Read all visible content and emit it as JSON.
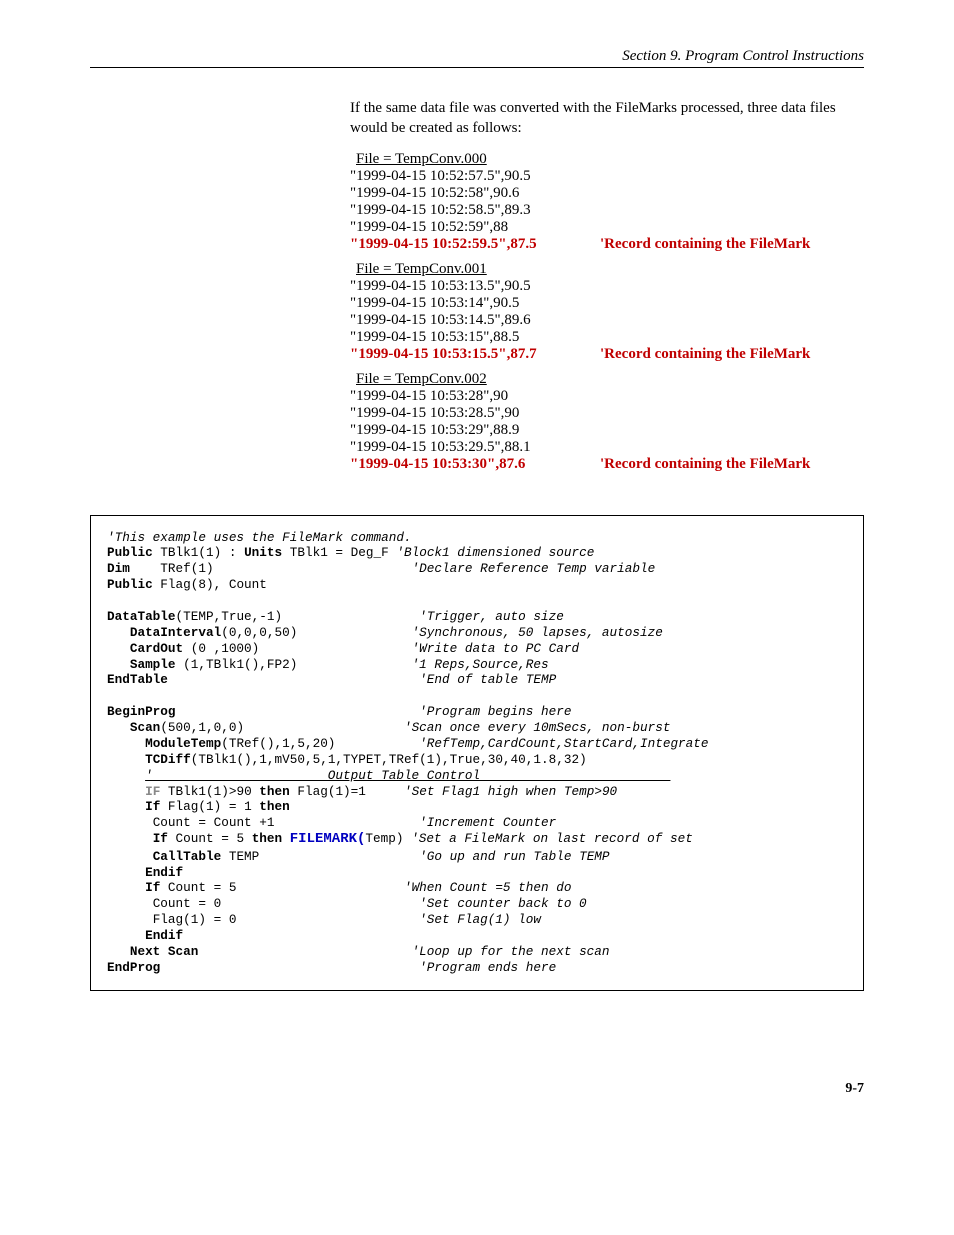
{
  "header": {
    "section_title": "Section 9.  Program Control Instructions"
  },
  "intro_text": "If the same data file was converted with the FileMarks processed, three data files would be created as follows:",
  "files": [
    {
      "title": " File = TempConv.000",
      "rows": [
        "\"1999-04-15 10:52:57.5\",90.5",
        "\"1999-04-15 10:52:58\",90.6",
        "\"1999-04-15 10:52:58.5\",89.3",
        "\"1999-04-15 10:52:59\",88"
      ],
      "mark_row": "\"1999-04-15 10:52:59.5\",87.5",
      "mark_label": "'Record containing the FileMark"
    },
    {
      "title": " File = TempConv.001",
      "rows": [
        "\"1999-04-15 10:53:13.5\",90.5",
        "\"1999-04-15 10:53:14\",90.5",
        "\"1999-04-15 10:53:14.5\",89.6",
        "\"1999-04-15 10:53:15\",88.5"
      ],
      "mark_row": "\"1999-04-15 10:53:15.5\",87.7",
      "mark_label": "'Record containing the FileMark"
    },
    {
      "title": " File = TempConv.002",
      "rows": [
        "\"1999-04-15 10:53:28\",90",
        "\"1999-04-15 10:53:28.5\",90",
        "\"1999-04-15 10:53:29\",88.9",
        "\"1999-04-15 10:53:29.5\",88.1"
      ],
      "mark_row": "\"1999-04-15 10:53:30\",87.6",
      "mark_label": "'Record containing the FileMark"
    }
  ],
  "code": {
    "c0": "'This example uses the FileMark command.",
    "l1_kw1": "Public",
    "l1_rest1": " TBlk1(1) : ",
    "l1_kw2": "Units",
    "l1_rest2": " TBlk1 = Deg_F ",
    "l1_cmt": "'Block1 dimensioned source",
    "l2_kw": "Dim",
    "l2_rest": "    TRef(1)                          ",
    "l2_cmt": "'Declare Reference Temp variable",
    "l3_kw": "Public",
    "l3_rest": " Flag(8), Count",
    "l4_kw": "DataTable",
    "l4_rest": "(TEMP,True,-1)                  ",
    "l4_cmt": "'Trigger, auto size",
    "l5_pre": "   ",
    "l5_kw": "DataInterval",
    "l5_rest": "(0,0,0,50)               ",
    "l5_cmt": "'Synchronous, 50 lapses, autosize",
    "l6_pre": "   ",
    "l6_kw": "CardOut",
    "l6_rest": " (0 ,1000)                    ",
    "l6_cmt": "'Write data to PC Card",
    "l7_pre": "   ",
    "l7_kw": "Sample",
    "l7_rest": " (1,TBlk1(),FP2)               ",
    "l7_cmt": "'1 Reps,Source,Res",
    "l8_kw": "EndTable",
    "l8_rest": "                                 ",
    "l8_cmt": "'End of table TEMP",
    "l9_kw": "BeginProg",
    "l9_rest": "                                ",
    "l9_cmt": "'Program begins here",
    "l10_pre": "   ",
    "l10_kw": "Scan",
    "l10_rest": "(500,1,0,0)                     ",
    "l10_cmt": "'Scan once every 10mSecs, non-burst",
    "l11_pre": "     ",
    "l11_kw": "ModuleTemp",
    "l11_rest": "(TRef(),1,5,20)           ",
    "l11_cmt": "'RefTemp,CardCount,StartCard,Integrate",
    "l12_pre": "     ",
    "l12_kw": "TCDiff",
    "l12_rest": "(TBlk1(),1,mV50,5,1,TYPET,TRef(1),True,30,40,1.8,32)",
    "l13_pre": "     ",
    "l13_cmt_a": "'______________________ Output Table Control ________________________",
    "l14_pre": "     ",
    "l14_kw1": "IF",
    "l14_m1": " TBlk1(1)>90 ",
    "l14_kw2": "then",
    "l14_m2": " Flag(1)=1     ",
    "l14_cmt": "'Set Flag1 high when Temp>90",
    "l15_pre": "     ",
    "l15_kw1": "If",
    "l15_m1": " Flag(1) = 1 ",
    "l15_kw2": "then",
    "l16_pre": "      ",
    "l16_rest": "Count = Count +1                   ",
    "l16_cmt": "'Increment Counter",
    "l17_pre": "      ",
    "l17_kw1": "If",
    "l17_m1": " Count = 5 ",
    "l17_kw2": "then",
    "l17_sp": " ",
    "l17_hl": "FILEMARK(",
    "l17_m2": "Temp) ",
    "l17_cmt": "'Set a FileMark on last record of set",
    "l18_pre": "      ",
    "l18_kw": "CallTable",
    "l18_rest": " TEMP                     ",
    "l18_cmt": "'Go up and run Table TEMP",
    "l19_pre": "     ",
    "l19_kw": "Endif",
    "l20_pre": "     ",
    "l20_kw": "If",
    "l20_rest": " Count = 5                      ",
    "l20_cmt": "'When Count =5 then do",
    "l21_pre": "      ",
    "l21_rest": "Count = 0                          ",
    "l21_cmt": "'Set counter back to 0",
    "l22_pre": "      ",
    "l22_rest": "Flag(1) = 0                        ",
    "l22_cmt": "'Set Flag(1) low",
    "l23_pre": "     ",
    "l23_kw": "Endif",
    "l24_pre": "   ",
    "l24_kw": "Next Scan",
    "l24_rest": "                            ",
    "l24_cmt": "'Loop up for the next scan",
    "l25_kw": "EndProg",
    "l25_rest": "                                  ",
    "l25_cmt": "'Program ends here"
  },
  "page_number": "9-7"
}
